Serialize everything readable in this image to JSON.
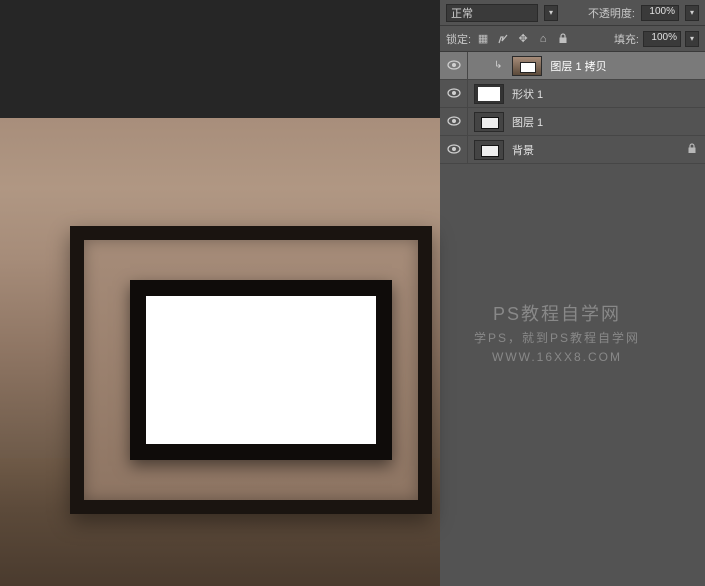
{
  "panel": {
    "blend_mode": "正常",
    "opacity_label": "不透明度:",
    "opacity_value": "100%",
    "lock_label": "锁定:",
    "fill_label": "填充:",
    "fill_value": "100%"
  },
  "layers": [
    {
      "name": "图层 1 拷贝",
      "selected": true,
      "indent": true,
      "thumb": "frame-img",
      "locked": false,
      "linked": true
    },
    {
      "name": "形状 1",
      "selected": false,
      "indent": false,
      "thumb": "shape",
      "locked": false,
      "linked": false
    },
    {
      "name": "图层 1",
      "selected": false,
      "indent": false,
      "thumb": "sm-frame",
      "locked": false,
      "linked": false
    },
    {
      "name": "背景",
      "selected": false,
      "indent": false,
      "thumb": "sm-frame",
      "locked": true,
      "linked": false
    }
  ],
  "watermark": {
    "line1": "PS教程自学网",
    "line2": "学PS，就到PS教程自学网",
    "line3": "WWW.16XX8.COM"
  }
}
